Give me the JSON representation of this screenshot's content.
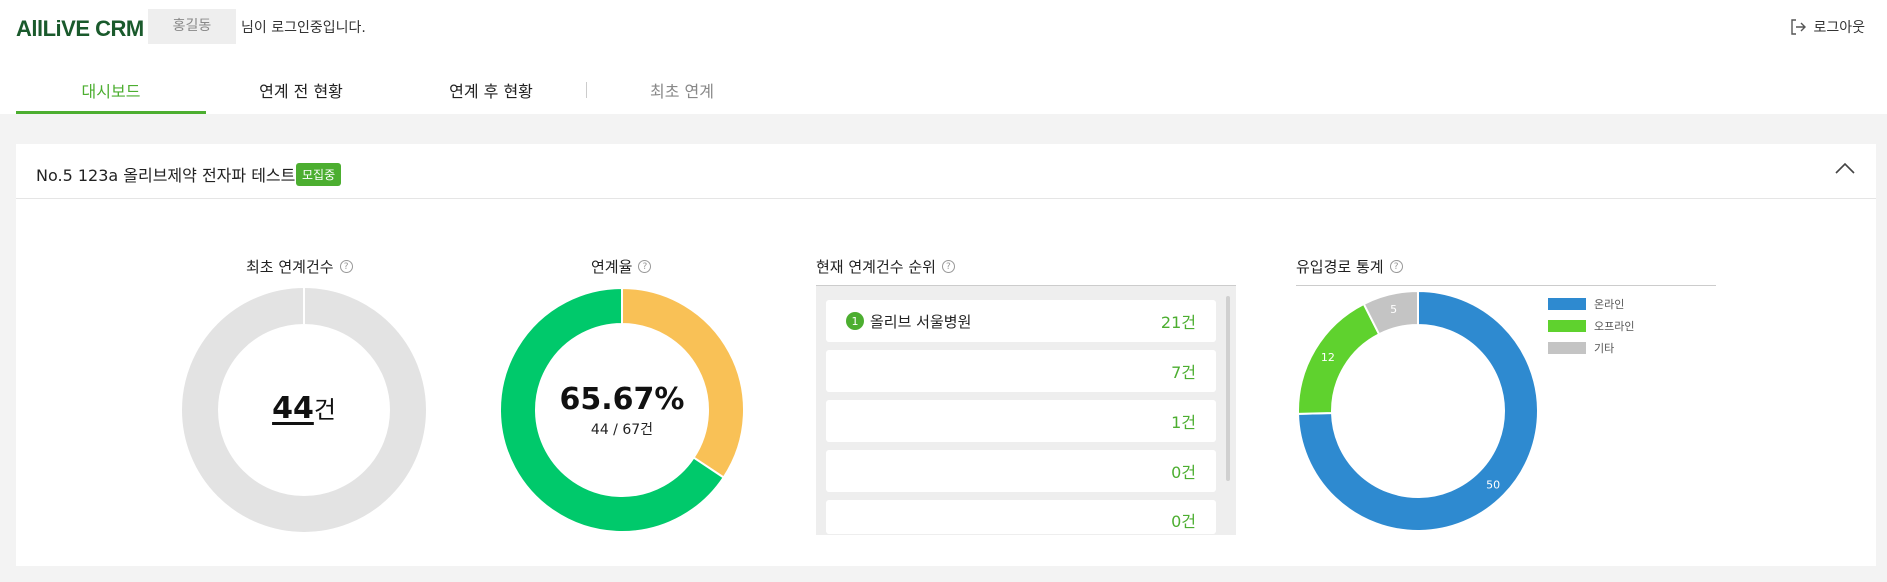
{
  "header": {
    "logo": "AllLiVE CRM",
    "user_name": "홍길동",
    "login_message": "님이 로그인중입니다.",
    "logout_label": "로그아웃"
  },
  "tabs": [
    {
      "label": "대시보드",
      "state": "active"
    },
    {
      "label": "연계 전 현황",
      "state": "normal"
    },
    {
      "label": "연계 후 현황",
      "state": "normal"
    },
    {
      "label": "최초 연계",
      "state": "disabled"
    }
  ],
  "project": {
    "title": "No.5 123a 올리브제약 전자파 테스트",
    "status_badge": "모집중"
  },
  "first_link": {
    "title": "최초 연계건수",
    "count": "44",
    "unit": "건"
  },
  "link_rate": {
    "title": "연계율",
    "rate": "65.67%",
    "ratio_text": "44 / 67건",
    "value_fraction": 0.6567,
    "colors": {
      "filled": "#00c96b",
      "remainder": "#f9c156"
    }
  },
  "rank": {
    "title": "현재 연계건수 순위",
    "items": [
      {
        "rank": "1",
        "name": "올리브 서울병원",
        "count": "21건"
      },
      {
        "rank": "",
        "name": "",
        "count": "7건"
      },
      {
        "rank": "",
        "name": "",
        "count": "1건"
      },
      {
        "rank": "",
        "name": "",
        "count": "0건"
      },
      {
        "rank": "",
        "name": "",
        "count": "0건"
      }
    ]
  },
  "inflow": {
    "title": "유입경로 통계",
    "chart_data": {
      "type": "pie",
      "categories": [
        "온라인",
        "오프라인",
        "기타"
      ],
      "values": [
        50,
        12,
        5
      ],
      "colors": [
        "#2e8ad0",
        "#5fd22e",
        "#c4c4c4"
      ],
      "legend_position": "top-right"
    }
  },
  "colors": {
    "accent": "#4cae30",
    "logo": "#1a5a2c"
  }
}
